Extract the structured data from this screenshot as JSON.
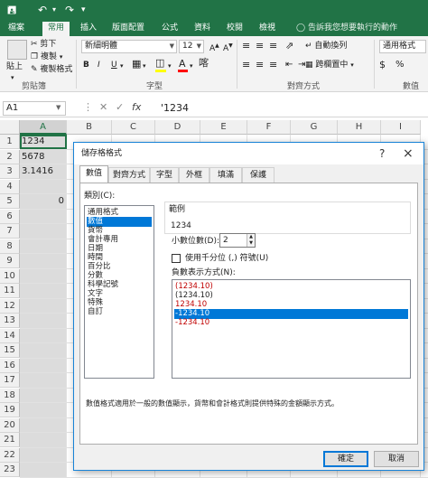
{
  "titlebar": {
    "save_icon": "save-icon",
    "undo_icon": "undo-icon",
    "redo_icon": "redo-icon"
  },
  "tabs": [
    {
      "label": "檔案"
    },
    {
      "label": "常用"
    },
    {
      "label": "插入"
    },
    {
      "label": "版面配置"
    },
    {
      "label": "公式"
    },
    {
      "label": "資料"
    },
    {
      "label": "校閱"
    },
    {
      "label": "檢視"
    }
  ],
  "active_tab": "常用",
  "tell_me": "告訴我您想要執行的動作",
  "ribbon": {
    "paste": "貼上",
    "cut": "剪下",
    "copy": "複製",
    "format_painter": "複製格式",
    "clipboard_group": "剪貼簿",
    "font_name": "新細明體",
    "font_size": "12",
    "font_group": "字型",
    "bold": "B",
    "italic": "I",
    "underline": "U",
    "align_group": "對齊方式",
    "wrap_text": "自動換列",
    "merge_center": "跨欄置中",
    "number_format": "通用格式",
    "number_group": "數值"
  },
  "formula_bar": {
    "name_box": "A1",
    "formula": "'1234"
  },
  "columns": [
    "A",
    "B",
    "C",
    "D",
    "E",
    "F",
    "G",
    "H",
    "I"
  ],
  "rows": [
    "1",
    "2",
    "3",
    "4",
    "5",
    "6",
    "7",
    "8",
    "9",
    "10",
    "11",
    "12",
    "13",
    "14",
    "15",
    "16",
    "17",
    "18",
    "19",
    "20",
    "21",
    "22",
    "23"
  ],
  "cells": [
    {
      "row": "1",
      "value": "1234",
      "align": "left"
    },
    {
      "row": "2",
      "value": "5678",
      "align": "left"
    },
    {
      "row": "3",
      "value": "3.1416",
      "align": "left"
    },
    {
      "row": "5",
      "value": "0",
      "align": "right"
    }
  ],
  "dialog": {
    "title": "儲存格格式",
    "help": "?",
    "close": "×",
    "tabs": [
      "數值",
      "對齊方式",
      "字型",
      "外框",
      "填滿",
      "保護"
    ],
    "active_tab": "數值",
    "category_label": "類別(C):",
    "categories": [
      "通用格式",
      "數值",
      "貨幣",
      "會計專用",
      "日期",
      "時間",
      "百分比",
      "分數",
      "科學記號",
      "文字",
      "特殊",
      "自訂"
    ],
    "selected_category": "數值",
    "sample_label": "範例",
    "sample_value": "1234",
    "decimal_label": "小數位數(D):",
    "decimal_value": "2",
    "thousands_label": "使用千分位 (,) 符號(U)",
    "thousands_checked": false,
    "negative_label": "負數表示方式(N):",
    "negative_formats": [
      {
        "text": "(1234.10)",
        "color": "#c00000"
      },
      {
        "text": "(1234.10)",
        "color": "#222222"
      },
      {
        "text": "1234.10",
        "color": "#c00000"
      },
      {
        "text": "-1234.10",
        "color": "#222222"
      },
      {
        "text": "-1234.10",
        "color": "#c00000"
      }
    ],
    "selected_negative": 3,
    "description": "數值格式適用於一般的數值顯示，貨幣和會計格式則提供特殊的金額顯示方式。",
    "ok": "確定",
    "cancel": "取消"
  },
  "colors": {
    "excel_green": "#217346",
    "selection_blue": "#0078d7",
    "negative_red": "#c00000"
  }
}
